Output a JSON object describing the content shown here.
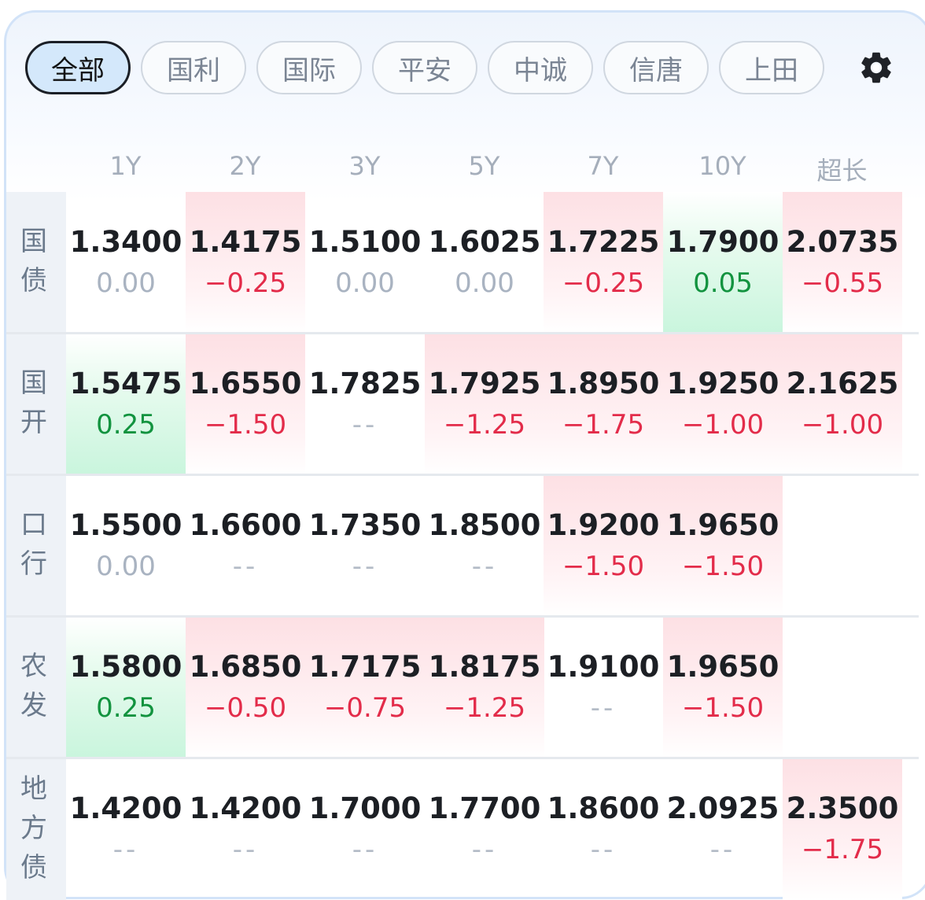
{
  "tabs": [
    "全部",
    "国利",
    "国际",
    "平安",
    "中诚",
    "信唐",
    "上田"
  ],
  "active_tab": 0,
  "settings_icon": "gear-icon",
  "columns": [
    "1Y",
    "2Y",
    "3Y",
    "5Y",
    "7Y",
    "10Y",
    "超长"
  ],
  "colors": {
    "up": "#e32c4a",
    "down": "#12933f",
    "accent": "#d4e8fb"
  },
  "rows": [
    {
      "label": [
        "国",
        "债"
      ],
      "cells": [
        {
          "rate": "1.3400",
          "change": "0.00",
          "dir": "zero"
        },
        {
          "rate": "1.4175",
          "change": "−0.25",
          "dir": "up"
        },
        {
          "rate": "1.5100",
          "change": "0.00",
          "dir": "zero"
        },
        {
          "rate": "1.6025",
          "change": "0.00",
          "dir": "zero"
        },
        {
          "rate": "1.7225",
          "change": "−0.25",
          "dir": "up"
        },
        {
          "rate": "1.7900",
          "change": "0.05",
          "dir": "down"
        },
        {
          "rate": "2.0735",
          "change": "−0.55",
          "dir": "up"
        }
      ]
    },
    {
      "label": [
        "国",
        "开"
      ],
      "cells": [
        {
          "rate": "1.5475",
          "change": "0.25",
          "dir": "down"
        },
        {
          "rate": "1.6550",
          "change": "−1.50",
          "dir": "up"
        },
        {
          "rate": "1.7825",
          "change": "--",
          "dir": "none"
        },
        {
          "rate": "1.7925",
          "change": "−1.25",
          "dir": "up"
        },
        {
          "rate": "1.8950",
          "change": "−1.75",
          "dir": "up"
        },
        {
          "rate": "1.9250",
          "change": "−1.00",
          "dir": "up"
        },
        {
          "rate": "2.1625",
          "change": "−1.00",
          "dir": "up"
        }
      ]
    },
    {
      "label": [
        "口",
        "行"
      ],
      "cells": [
        {
          "rate": "1.5500",
          "change": "0.00",
          "dir": "zero"
        },
        {
          "rate": "1.6600",
          "change": "--",
          "dir": "none"
        },
        {
          "rate": "1.7350",
          "change": "--",
          "dir": "none"
        },
        {
          "rate": "1.8500",
          "change": "--",
          "dir": "none"
        },
        {
          "rate": "1.9200",
          "change": "−1.50",
          "dir": "up"
        },
        {
          "rate": "1.9650",
          "change": "−1.50",
          "dir": "up"
        },
        {
          "rate": "",
          "change": "",
          "dir": "empty"
        }
      ]
    },
    {
      "label": [
        "农",
        "发"
      ],
      "cells": [
        {
          "rate": "1.5800",
          "change": "0.25",
          "dir": "down"
        },
        {
          "rate": "1.6850",
          "change": "−0.50",
          "dir": "up"
        },
        {
          "rate": "1.7175",
          "change": "−0.75",
          "dir": "up"
        },
        {
          "rate": "1.8175",
          "change": "−1.25",
          "dir": "up"
        },
        {
          "rate": "1.9100",
          "change": "--",
          "dir": "none"
        },
        {
          "rate": "1.9650",
          "change": "−1.50",
          "dir": "up"
        },
        {
          "rate": "",
          "change": "",
          "dir": "empty"
        }
      ]
    },
    {
      "label": [
        "地",
        "方",
        "债"
      ],
      "cells": [
        {
          "rate": "1.4200",
          "change": "--",
          "dir": "none"
        },
        {
          "rate": "1.4200",
          "change": "--",
          "dir": "none"
        },
        {
          "rate": "1.7000",
          "change": "--",
          "dir": "none"
        },
        {
          "rate": "1.7700",
          "change": "--",
          "dir": "none"
        },
        {
          "rate": "1.8600",
          "change": "--",
          "dir": "none"
        },
        {
          "rate": "2.0925",
          "change": "--",
          "dir": "none"
        },
        {
          "rate": "2.3500",
          "change": "−1.75",
          "dir": "up"
        }
      ]
    }
  ]
}
